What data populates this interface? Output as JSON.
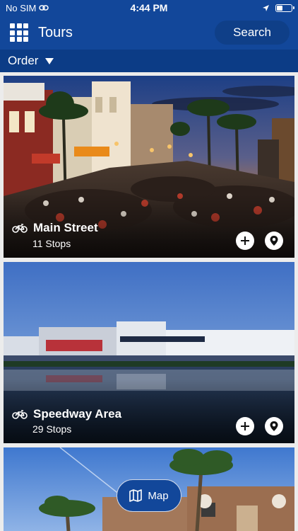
{
  "status": {
    "carrier": "No SIM",
    "time": "4:44 PM",
    "battery_level": 0.35
  },
  "header": {
    "title": "Tours",
    "search_label": "Search"
  },
  "order": {
    "label": "Order"
  },
  "tours": [
    {
      "name": "Main Street",
      "stops": "11 Stops",
      "icon": "motorcycle-icon"
    },
    {
      "name": "Speedway Area",
      "stops": "29 Stops",
      "icon": "motorcycle-icon"
    }
  ],
  "map_button": {
    "label": "Map"
  },
  "colors": {
    "primary": "#12479a",
    "order_bar": "#0c3c86",
    "background": "#ececec"
  }
}
